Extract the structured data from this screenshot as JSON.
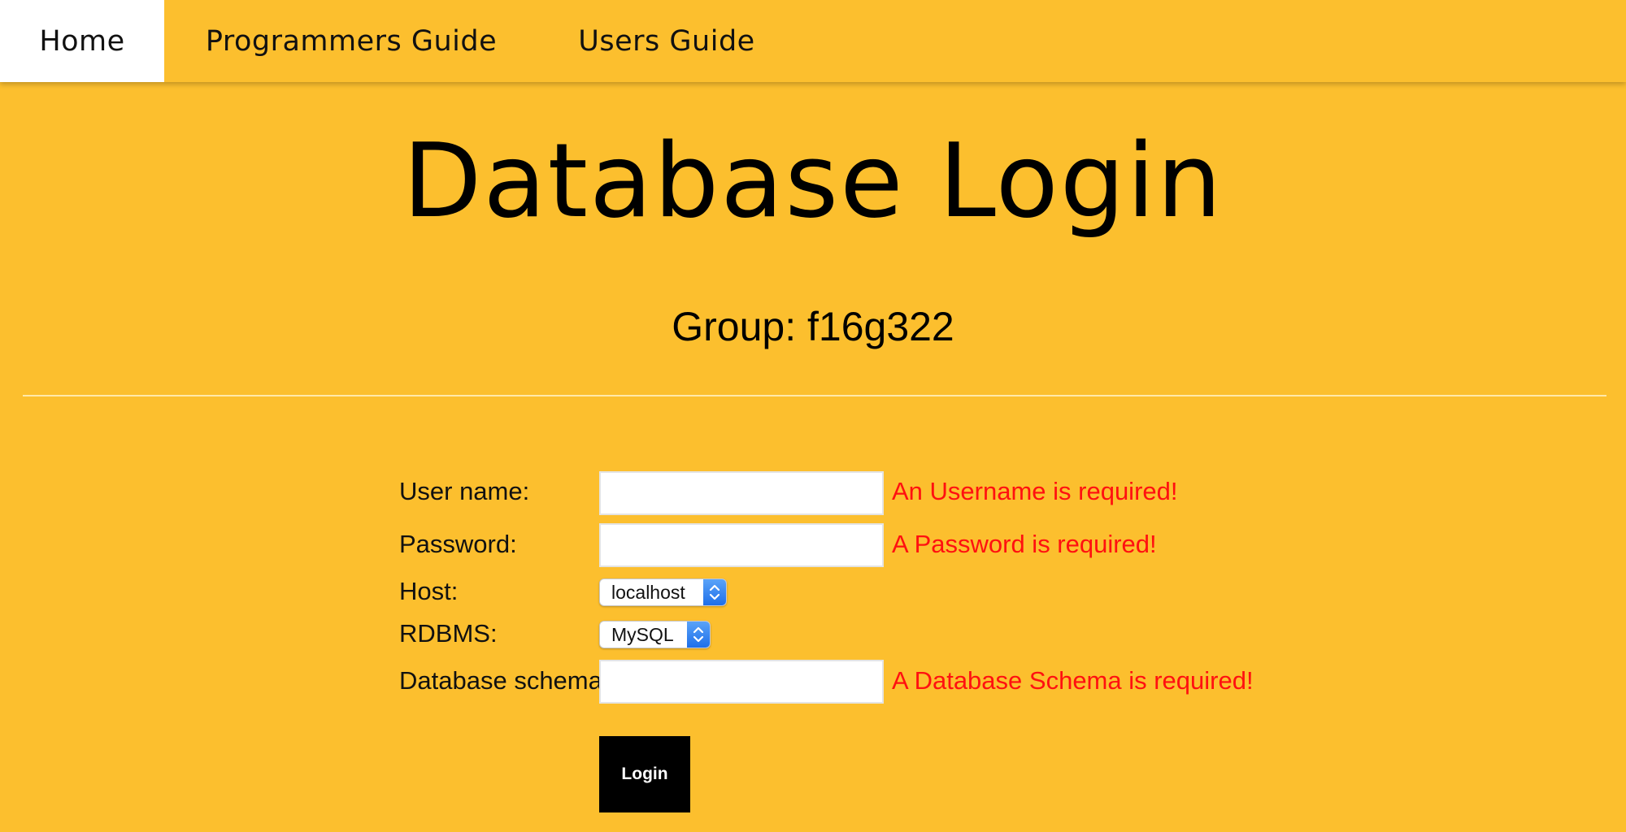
{
  "nav": {
    "home": "Home",
    "programmers_guide": "Programmers Guide",
    "users_guide": "Users Guide"
  },
  "title": "Database Login",
  "group": "Group: f16g322",
  "form": {
    "username_label": "User name:",
    "username_value": "",
    "username_error": "An Username is required!",
    "password_label": "Password:",
    "password_value": "",
    "password_error": "A Password is required!",
    "host_label": "Host:",
    "host_selected": "localhost",
    "rdbms_label": "RDBMS:",
    "rdbms_selected": "MySQL",
    "schema_label": "Database schema:",
    "schema_value": "",
    "schema_error": "A Database Schema is required!",
    "login_label": "Login"
  },
  "colors": {
    "background": "#FCBF2E",
    "active_tab": "#FFFFFF",
    "error": "#FF1010",
    "button": "#000000",
    "select_accent": "#1E6FEA"
  },
  "icons": {
    "select_arrows": "chevron-up-down-icon"
  }
}
